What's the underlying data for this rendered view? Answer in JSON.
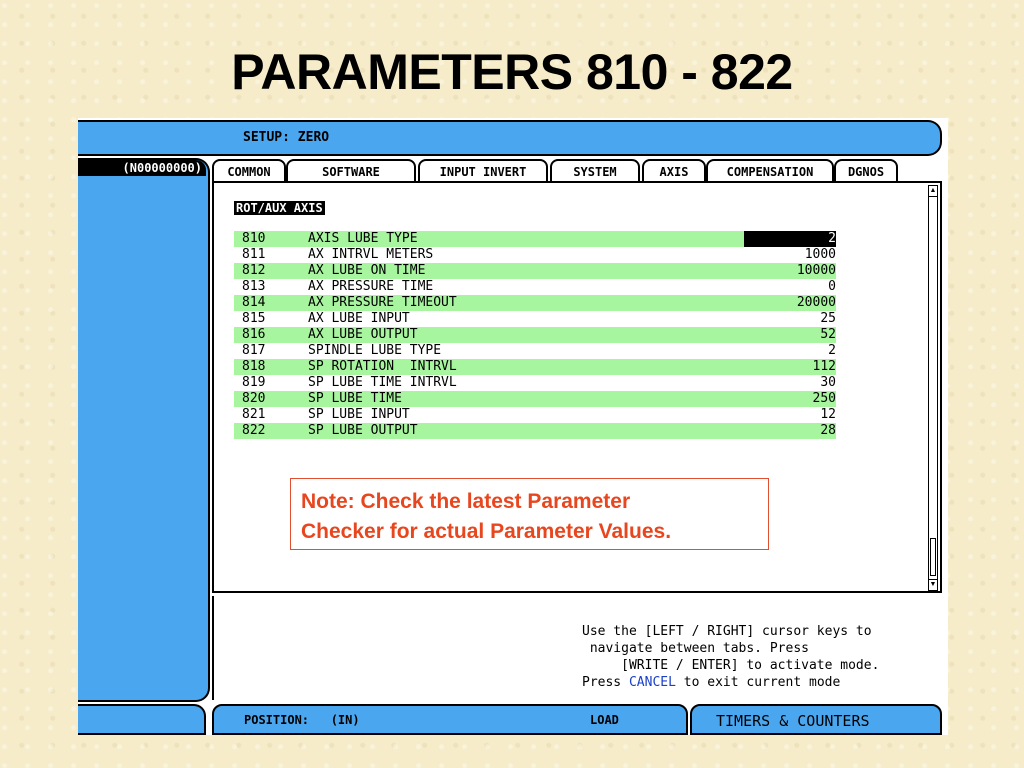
{
  "slide": {
    "title": "PARAMETERS 810 - 822"
  },
  "header": {
    "setup_label": "SETUP:  ZERO",
    "program_code": "(N00000000)"
  },
  "tabs": [
    {
      "label": "COMMON",
      "active": true
    },
    {
      "label": "SOFTWARE"
    },
    {
      "label": "INPUT INVERT"
    },
    {
      "label": "SYSTEM"
    },
    {
      "label": "AXIS"
    },
    {
      "label": "COMPENSATION"
    },
    {
      "label": "DGNOS"
    }
  ],
  "section": {
    "title": "ROT/AUX AXIS"
  },
  "parameters": [
    {
      "num": "810",
      "name": "AXIS LUBE TYPE",
      "value": "2",
      "selected": true
    },
    {
      "num": "811",
      "name": "AX INTRVL METERS",
      "value": "1000"
    },
    {
      "num": "812",
      "name": "AX LUBE ON TIME",
      "value": "10000"
    },
    {
      "num": "813",
      "name": "AX PRESSURE TIME",
      "value": "0"
    },
    {
      "num": "814",
      "name": "AX PRESSURE TIMEOUT",
      "value": "20000"
    },
    {
      "num": "815",
      "name": "AX LUBE INPUT",
      "value": "25"
    },
    {
      "num": "816",
      "name": "AX LUBE OUTPUT",
      "value": "52"
    },
    {
      "num": "817",
      "name": "SPINDLE LUBE TYPE",
      "value": "2"
    },
    {
      "num": "818",
      "name": "SP ROTATION  INTRVL",
      "value": "112"
    },
    {
      "num": "819",
      "name": "SP LUBE TIME INTRVL",
      "value": "30"
    },
    {
      "num": "820",
      "name": "SP LUBE TIME",
      "value": "250"
    },
    {
      "num": "821",
      "name": "SP LUBE INPUT",
      "value": "12"
    },
    {
      "num": "822",
      "name": "SP LUBE OUTPUT",
      "value": "28"
    }
  ],
  "note": {
    "line1": "Note:  Check the latest Parameter",
    "line2": "Checker for actual Parameter Values."
  },
  "help": {
    "line1": "Use the [LEFT / RIGHT] cursor keys to",
    "line2": " navigate between tabs. Press",
    "line3": "     [WRITE / ENTER] to activate mode.",
    "line4_pre": "Press ",
    "line4_cancel": "CANCEL",
    "line4_post": " to exit current mode"
  },
  "footer": {
    "position": "POSITION:   (IN)",
    "load": "LOAD",
    "timers": "TIMERS & COUNTERS"
  },
  "colors": {
    "panel_blue": "#4aa6ef",
    "row_green": "#a8f5a0",
    "note_red": "#e8461e",
    "cancel_blue": "#1a3fc8"
  }
}
